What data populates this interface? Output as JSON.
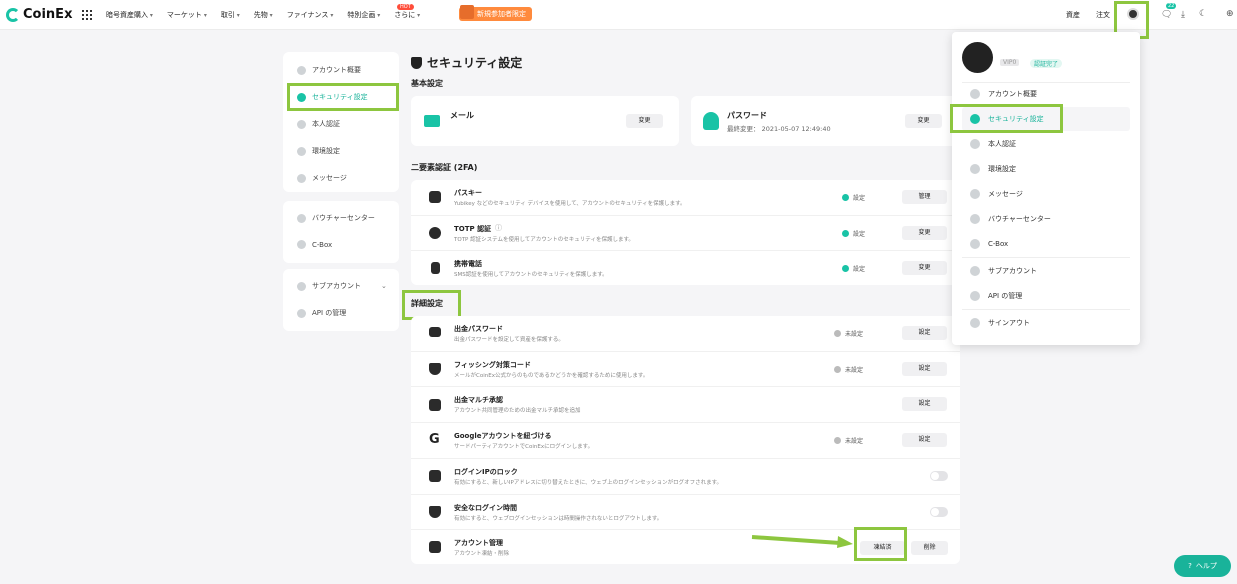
{
  "header": {
    "brand": "CoinEx",
    "nav": [
      "暗号資産購入",
      "マーケット",
      "取引",
      "先物",
      "ファイナンス",
      "特別企画",
      "さらに"
    ],
    "hot_badge": "HOT",
    "promo": "新規参加者限定",
    "assets": "資産",
    "orders": "注文",
    "notification_count": "22"
  },
  "sidebar": {
    "groups": [
      [
        "アカウント概要",
        "セキュリティ設定",
        "本人認証",
        "環境設定",
        "メッセージ"
      ],
      [
        "バウチャーセンター",
        "C-Box"
      ],
      [
        "サブアカウント",
        "API の管理"
      ]
    ]
  },
  "page": {
    "title": "セキュリティ設定",
    "basic_title": "基本設定",
    "email_label": "メール",
    "email_btn": "変更",
    "password_label": "パスワード",
    "password_sub": "最終変更： 2021-05-07 12:49:40",
    "password_btn": "変更",
    "twofa_title": "二要素認証 (2FA)",
    "twofa_rows": [
      {
        "title": "パスキー",
        "desc": "Yubikey などのセキュリティ デバイスを使用して、アカウントのセキュリティを保護します。",
        "status": "設定",
        "btn": "管理"
      },
      {
        "title": "TOTP 認証",
        "desc": "TOTP 認証システムを使用してアカウントのセキュリティを保護します。",
        "status": "設定",
        "btn": "変更"
      },
      {
        "title": "携帯電話",
        "desc": "SMS認証を使用してアカウントのセキュリティを保護します。",
        "status": "設定",
        "btn": "変更"
      }
    ],
    "advanced_title": "詳細設定",
    "advanced_rows": [
      {
        "title": "出金パスワード",
        "desc": "出金パスワードを設定して資産を保護する。",
        "status": "未設定",
        "btn": "設定"
      },
      {
        "title": "フィッシング対策コード",
        "desc": "メールがCoinEx公式からのものであるかどうかを確認するために使用します。",
        "status": "未設定",
        "btn": "設定"
      },
      {
        "title": "出金マルチ承認",
        "desc": "アカウント共同管理のための出金マルチ承認を追加",
        "status": "",
        "btn": "設定"
      },
      {
        "title": "Googleアカウントを紐づける",
        "desc": "サードパーティアカウントでCoinExにログインします。",
        "status": "未設定",
        "btn": "設定"
      },
      {
        "title": "ログインIPのロック",
        "desc": "有効にすると、新しいIPアドレスに切り替えたときに、ウェブ上のログインセッションがログオフされます。",
        "status": "",
        "btn": ""
      },
      {
        "title": "安全なログイン時間",
        "desc": "有効にすると、ウェブログインセッションは時間操作されないとログアウトします。",
        "status": "",
        "btn": ""
      },
      {
        "title": "アカウント管理",
        "desc": "アカウント凍結・削除",
        "status": "",
        "btn": "凍結済"
      }
    ],
    "delete_btn": "削除"
  },
  "dropdown": {
    "vip": "VIP0",
    "verified": "認証完了",
    "items": [
      "アカウント概要",
      "セキュリティ設定",
      "本人認証",
      "環境設定",
      "メッセージ",
      "バウチャーセンター",
      "C-Box",
      "サブアカウント",
      "API の管理",
      "サインアウト"
    ]
  },
  "help_label": "ヘルプ",
  "colors": {
    "accent": "#19c3a6",
    "highlight": "#8dc63f",
    "promo": "#ff8a3d"
  }
}
